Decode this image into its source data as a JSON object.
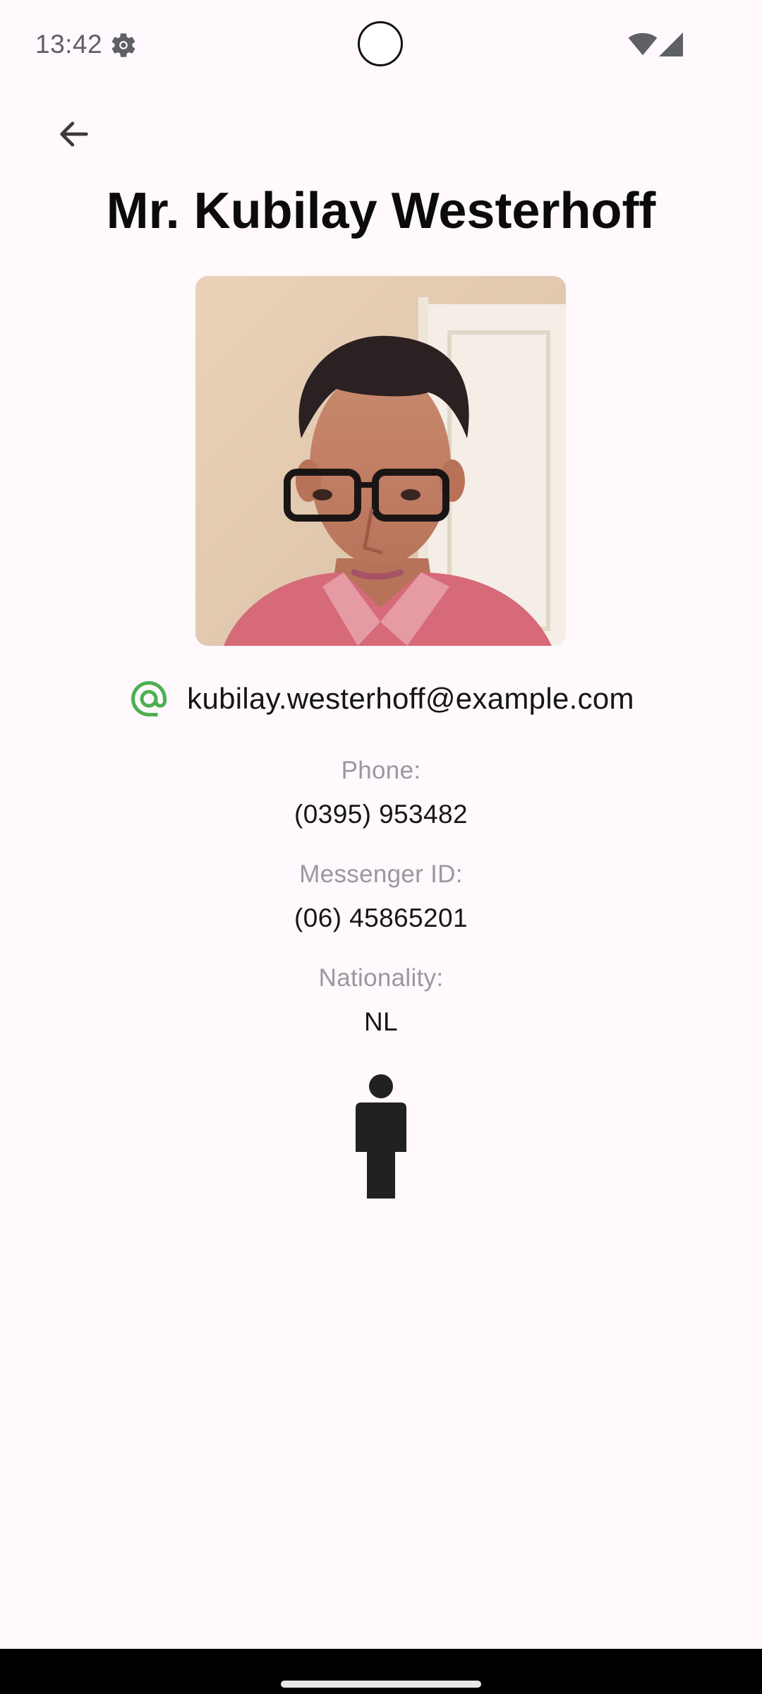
{
  "status_bar": {
    "time": "13:42",
    "icons": [
      "gear-icon",
      "camera-cutout",
      "wifi-icon",
      "signal-icon"
    ]
  },
  "app_bar": {
    "back_icon": "arrow-back-icon"
  },
  "profile": {
    "title": "Mr. Kubilay Westerhoff",
    "email": "kubilay.westerhoff@example.com",
    "email_icon": "at-sign-icon",
    "phone_label": "Phone:",
    "phone_value": "(0395) 953482",
    "messenger_label": "Messenger ID:",
    "messenger_value": "(06) 45865201",
    "nationality_label": "Nationality:",
    "nationality_value": "NL",
    "gender_icon": "male-person-icon"
  },
  "colors": {
    "background": "#fff8fc",
    "accent_green": "#4caf50",
    "label_gray": "#9a989d",
    "text_dark": "#161616"
  }
}
